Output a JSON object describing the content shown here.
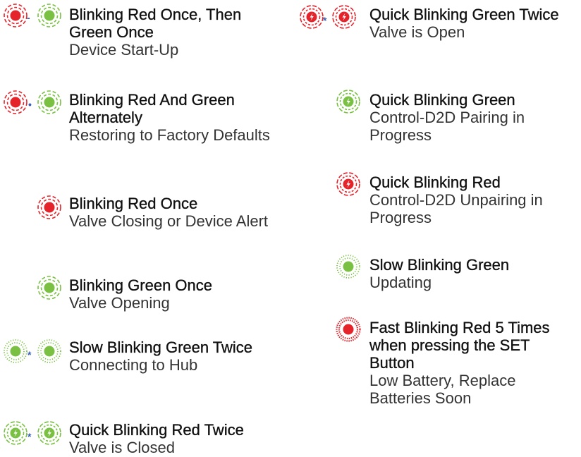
{
  "colors": {
    "red": "#e5232a",
    "green": "#7ac143",
    "sep": "#3a5fb0"
  },
  "left": [
    {
      "title": "Blinking Red Once, Then Green Once",
      "desc": "Device Start-Up",
      "icons": [
        "red-dashed-light-icon",
        "green-dashed-light-icon"
      ],
      "sep": "-"
    },
    {
      "title": "Blinking Red And Green Alternately",
      "desc": "Restoring to Factory Defaults",
      "icons": [
        "red-dashed-light-icon",
        "green-dashed-light-icon"
      ],
      "sep": "•"
    },
    {
      "title": "Blinking Red Once",
      "desc": "Valve Closing or Device Alert",
      "icons": [
        "red-dashed-light-icon"
      ]
    },
    {
      "title": "Blinking Green Once",
      "desc": "Valve Opening",
      "icons": [
        "green-dashed-light-icon"
      ]
    },
    {
      "title": "Slow Blinking Green Twice",
      "desc": "Connecting to Hub",
      "icons": [
        "green-dotted-light-icon",
        "green-dotted-light-icon"
      ],
      "sep": "*"
    },
    {
      "title": "Quick Blinking Red Twice",
      "desc": "Valve is Closed",
      "icons": [
        "green-quick-light-icon",
        "green-quick-light-icon"
      ],
      "sep": "*"
    }
  ],
  "right": [
    {
      "title": "Quick Blinking Green Twice",
      "desc": "Valve is Open",
      "icons": [
        "red-quick-light-icon",
        "red-quick-light-icon"
      ],
      "sep": "*"
    },
    {
      "title": "Quick Blinking Green",
      "desc": "Control-D2D Pairing in Progress",
      "icons": [
        "green-quick-light-icon"
      ]
    },
    {
      "title": "Quick Blinking Red",
      "desc": "Control-D2D Unpairing in Progress",
      "icons": [
        "red-quick-light-icon"
      ]
    },
    {
      "title": "Slow Blinking Green",
      "desc": "Updating",
      "icons": [
        "green-dotted-light-icon"
      ]
    },
    {
      "title": "Fast Blinking Red 5 Times when pressing the SET Button",
      "desc": "Low Battery, Replace Batteries Soon",
      "icons": [
        "red-fast-light-icon"
      ]
    }
  ]
}
